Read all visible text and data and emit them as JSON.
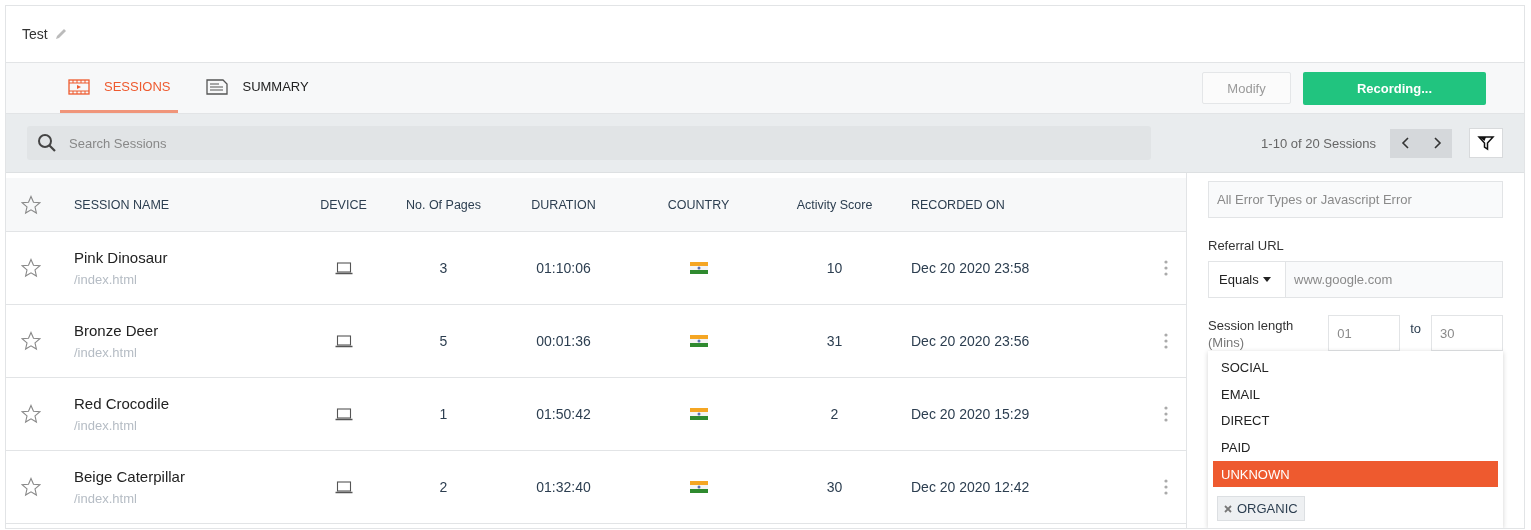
{
  "title": "Test",
  "tabs": [
    {
      "label": "SESSIONS",
      "selected": true,
      "kind": "film"
    },
    {
      "label": "SUMMARY",
      "selected": false,
      "kind": "doc"
    }
  ],
  "actions": {
    "modify": {
      "label": "Modify",
      "disabled": true
    },
    "recording": {
      "label": "Recording..."
    }
  },
  "search": {
    "placeholder": "Search Sessions"
  },
  "pagination": {
    "text": "1-10 of 20 Sessions"
  },
  "table": {
    "columns": [
      "SESSION NAME",
      "DEVICE",
      "No. Of Pages",
      "DURATION",
      "COUNTRY",
      "Activity Score",
      "RECORDED ON"
    ],
    "header_starred": false,
    "rows": [
      {
        "starred": false,
        "name": "Pink Dinosaur",
        "path": "/index.html",
        "pages": "3",
        "duration": "01:10:06",
        "score": "10",
        "recorded": "Dec 20 2020 23:58"
      },
      {
        "starred": false,
        "name": "Bronze Deer",
        "path": "/index.html",
        "pages": "5",
        "duration": "00:01:36",
        "score": "31",
        "recorded": "Dec 20 2020 23:56"
      },
      {
        "starred": false,
        "name": "Red Crocodile",
        "path": "/index.html",
        "pages": "1",
        "duration": "01:50:42",
        "score": "2",
        "recorded": "Dec 20 2020 15:29"
      },
      {
        "starred": false,
        "name": "Beige Caterpillar",
        "path": "/index.html",
        "pages": "2",
        "duration": "01:32:40",
        "score": "30",
        "recorded": "Dec 20 2020 12:42"
      }
    ]
  },
  "filters": {
    "error": {
      "placeholder": "All Error Types or Javascript Error"
    },
    "referral": {
      "label": "Referral URL",
      "operator": "Equals",
      "placeholder": "www.google.com"
    },
    "length": {
      "label": "Session length",
      "unit": "(Mins)",
      "from_placeholder": "01",
      "joiner": "to",
      "to_placeholder": "30"
    },
    "source_menu": [
      {
        "label": "SOCIAL",
        "selected": false
      },
      {
        "label": "EMAIL",
        "selected": false
      },
      {
        "label": "DIRECT",
        "selected": false
      },
      {
        "label": "PAID",
        "selected": false
      },
      {
        "label": "UNKNOWN",
        "selected": true
      }
    ],
    "tags": [
      {
        "label": "ORGANIC"
      }
    ]
  }
}
